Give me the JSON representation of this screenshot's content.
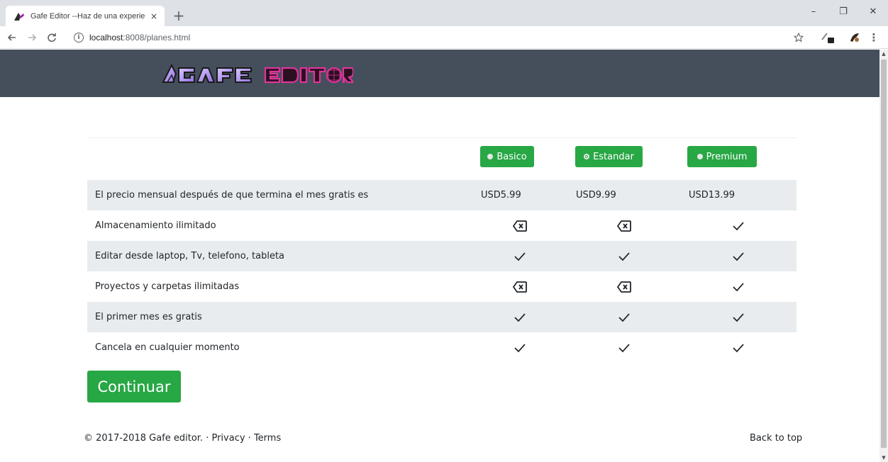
{
  "browser": {
    "tab_title": "Gafe Editor --Haz de una experie",
    "tab_close": "×",
    "new_tab": "+",
    "url_host": "localhost",
    "url_rest": ":8008/planes.html",
    "window_controls": {
      "minimize": "–",
      "restore": "❐",
      "close": "✕"
    }
  },
  "header": {
    "logo_text": "GAFE EDITOR"
  },
  "plans": [
    {
      "label": "Basico",
      "selected": false
    },
    {
      "label": "Estandar",
      "selected": true
    },
    {
      "label": "Premium",
      "selected": false
    }
  ],
  "table": {
    "rows": [
      {
        "feature": "El precio mensual después de que termina el mes gratis es",
        "values": [
          "USD5.99",
          "USD9.99",
          "USD13.99"
        ]
      },
      {
        "feature": "Almacenamiento ilimitado",
        "values": [
          "x",
          "x",
          "check"
        ]
      },
      {
        "feature": "Editar desde laptop, Tv, telefono, tableta",
        "values": [
          "check",
          "check",
          "check"
        ]
      },
      {
        "feature": "Proyectos y carpetas ilimitadas",
        "values": [
          "x",
          "x",
          "check"
        ]
      },
      {
        "feature": "El primer mes es gratis",
        "values": [
          "check",
          "check",
          "check"
        ]
      },
      {
        "feature": "Cancela en cualquier momento",
        "values": [
          "check",
          "check",
          "check"
        ]
      }
    ]
  },
  "continue_label": "Continuar",
  "footer": {
    "copyright": "© 2017-2018 Gafe editor. · ",
    "privacy": "Privacy",
    "sep": " · ",
    "terms": "Terms",
    "back_to_top": "Back to top"
  },
  "colors": {
    "header_bg": "#454f5c",
    "accent_green": "#28a745",
    "stripe": "#e9ecef"
  }
}
